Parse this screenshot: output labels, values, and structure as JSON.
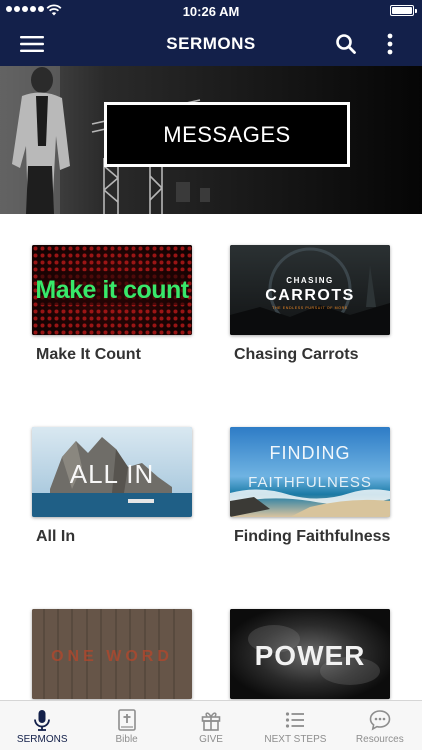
{
  "status_bar": {
    "time": "10:26 AM"
  },
  "nav": {
    "title": "SERMONS"
  },
  "hero": {
    "label": "MESSAGES"
  },
  "sermons": [
    {
      "title": "Make It Count",
      "art_text": "Make it count"
    },
    {
      "title": "Chasing Carrots",
      "art_eyebrow": "CHASING",
      "art_text": "CARROTS",
      "art_sub": "THE ENDLESS PURSUIT OF MORE"
    },
    {
      "title": "All In",
      "art_text": "ALL IN"
    },
    {
      "title": "Finding Faithfulness",
      "art_line1": "FINDING",
      "art_line2": "FAITHFULNESS"
    },
    {
      "title": "",
      "art_text": "ONE WORD"
    },
    {
      "title": "",
      "art_text": "POWER"
    }
  ],
  "tabs": [
    {
      "label": "SERMONS",
      "icon": "microphone-icon",
      "active": true
    },
    {
      "label": "Bible",
      "icon": "bible-icon",
      "active": false
    },
    {
      "label": "GIVE",
      "icon": "gift-icon",
      "active": false
    },
    {
      "label": "NEXT STEPS",
      "icon": "list-icon",
      "active": false
    },
    {
      "label": "Resources",
      "icon": "chat-bubble-icon",
      "active": false
    }
  ],
  "colors": {
    "nav_bg": "#13204a",
    "tab_active": "#13204a",
    "tab_inactive": "#8e8e8e"
  }
}
